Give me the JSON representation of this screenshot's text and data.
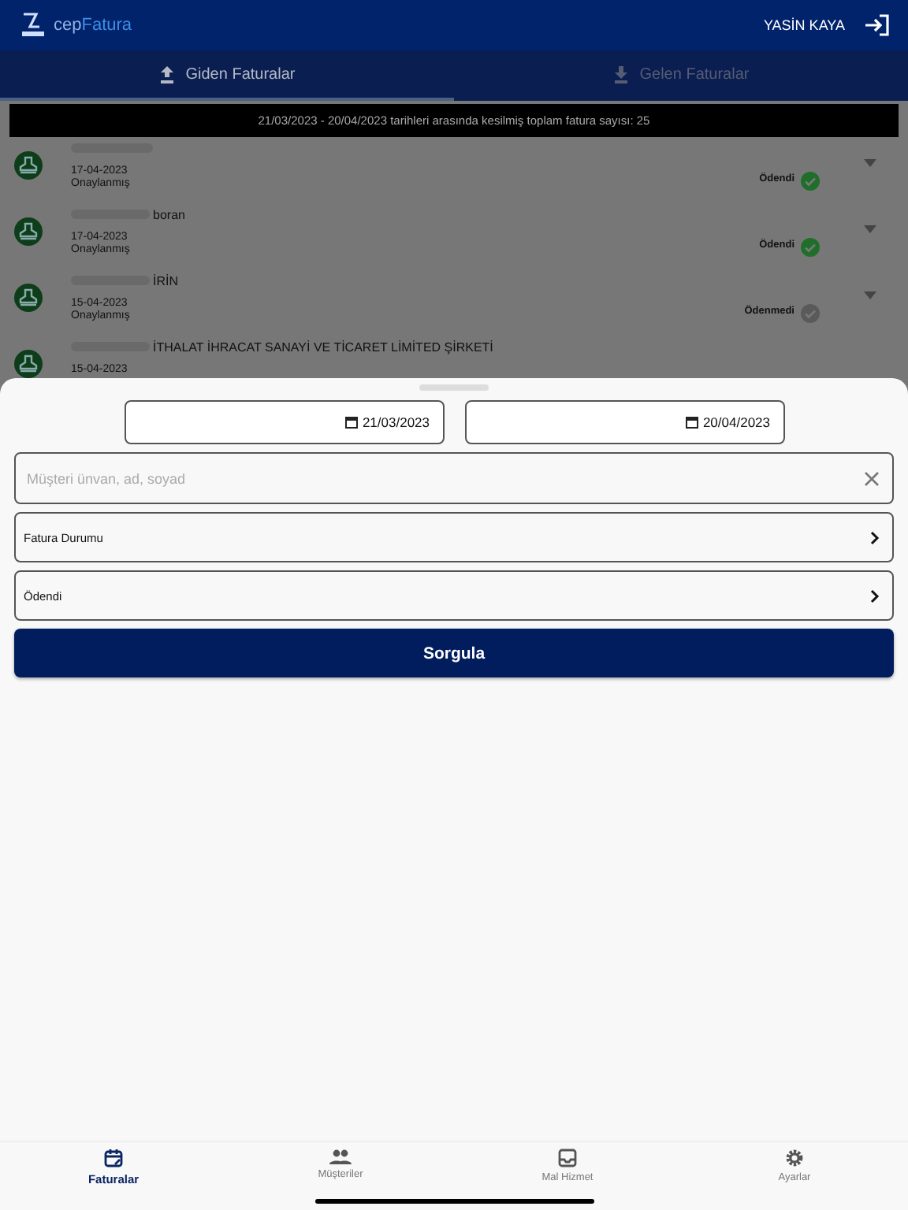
{
  "header": {
    "logo_prefix": "cep",
    "logo_suffix": "Fatura",
    "user": "YASİN KAYA"
  },
  "tabs": [
    {
      "label": "Giden Faturalar",
      "selected": true,
      "kind": "upload"
    },
    {
      "label": "Gelen Faturalar",
      "selected": false,
      "kind": "download"
    }
  ],
  "banner": "21/03/2023 - 20/04/2023 tarihleri arasında kesilmiş toplam fatura sayısı: 25",
  "invoices": [
    {
      "date": "17-04-2023",
      "state": "Onaylanmış",
      "payment": "Ödendi",
      "paid": true
    },
    {
      "name": "boran",
      "date": "17-04-2023",
      "state": "Onaylanmış",
      "payment": "Ödendi",
      "paid": true
    },
    {
      "name": "İRİN",
      "date": "15-04-2023",
      "state": "Onaylanmış",
      "payment": "Ödenmedi",
      "paid": false
    },
    {
      "name": "İTHALAT İHRACAT SANAYİ VE TİCARET LİMİTED ŞİRKETİ",
      "date": "15-04-2023"
    }
  ],
  "filter": {
    "start_date": "21/03/2023",
    "end_date": "20/04/2023",
    "customer": {
      "placeholder": "Müşteri ünvan, ad, soyad"
    },
    "options": [
      "Fatura Durumu",
      "Ödendi"
    ],
    "button": "Sorgula"
  },
  "nav": [
    {
      "label": "Faturalar",
      "selected": true,
      "kind": "invoices"
    },
    {
      "label": "Müşteriler",
      "selected": false,
      "kind": "customers"
    },
    {
      "label": "Mal Hizmet",
      "selected": false,
      "kind": "goods"
    },
    {
      "label": "Ayarlar",
      "selected": false,
      "kind": "settings"
    }
  ]
}
